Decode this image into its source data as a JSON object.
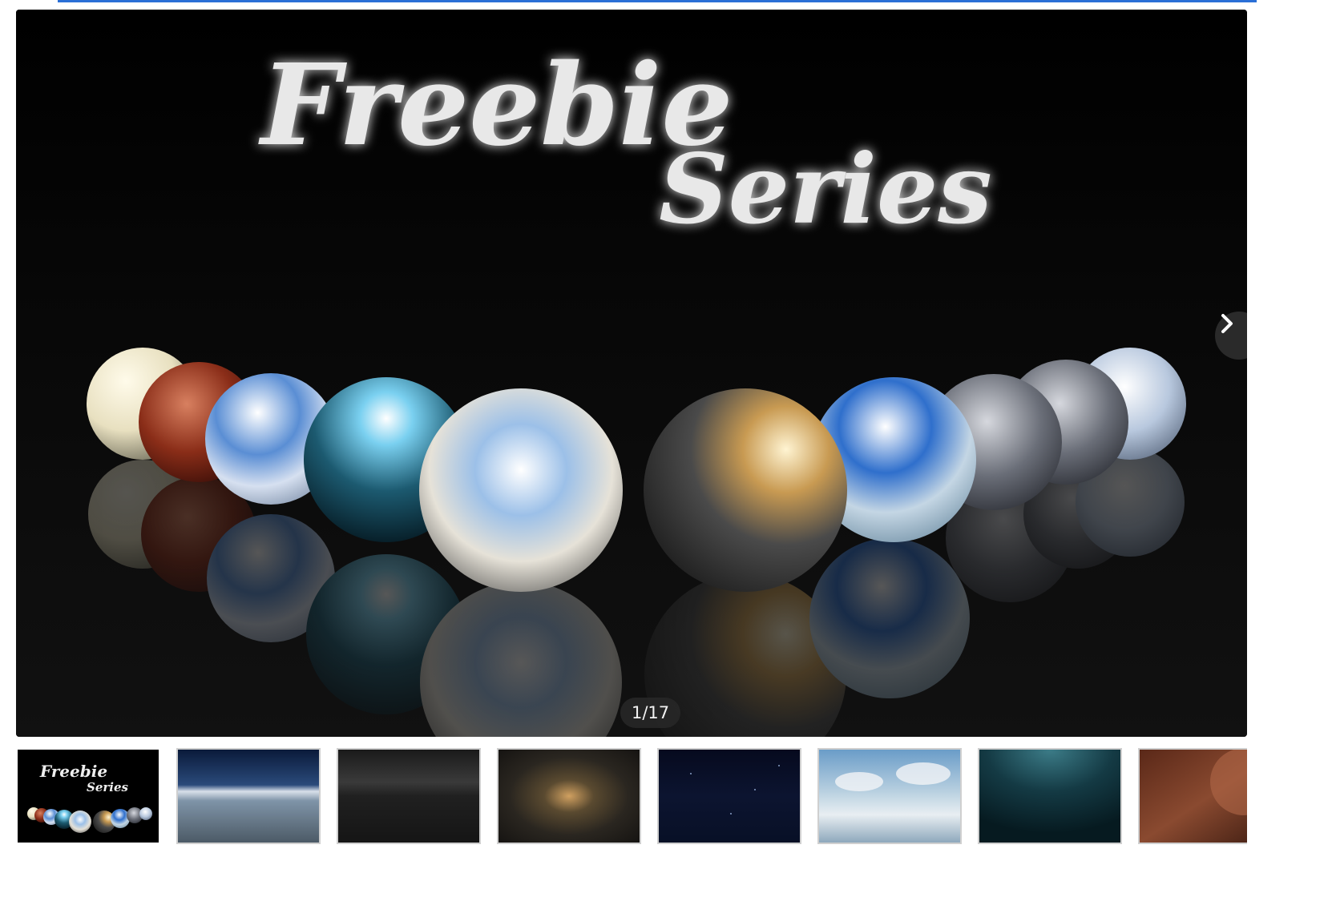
{
  "gallery": {
    "counter": "1/17",
    "current_index": 1,
    "total": 17,
    "banner_lines": [
      "Freebie",
      "Series"
    ],
    "next_icon": "chevron-right-icon",
    "thumbnails": [
      {
        "name": "freebie-series-cover",
        "selected": true
      },
      {
        "name": "blue-sky-horizon"
      },
      {
        "name": "dark-overcast"
      },
      {
        "name": "amber-sunset-clouds"
      },
      {
        "name": "starry-night"
      },
      {
        "name": "cloud-sea-daylight"
      },
      {
        "name": "teal-underwater"
      },
      {
        "name": "red-planet-landscape"
      }
    ]
  },
  "colors": {
    "accent": "#2a6fd6",
    "viewer_background": "#000000",
    "text_glow": "#e8e8e8"
  }
}
